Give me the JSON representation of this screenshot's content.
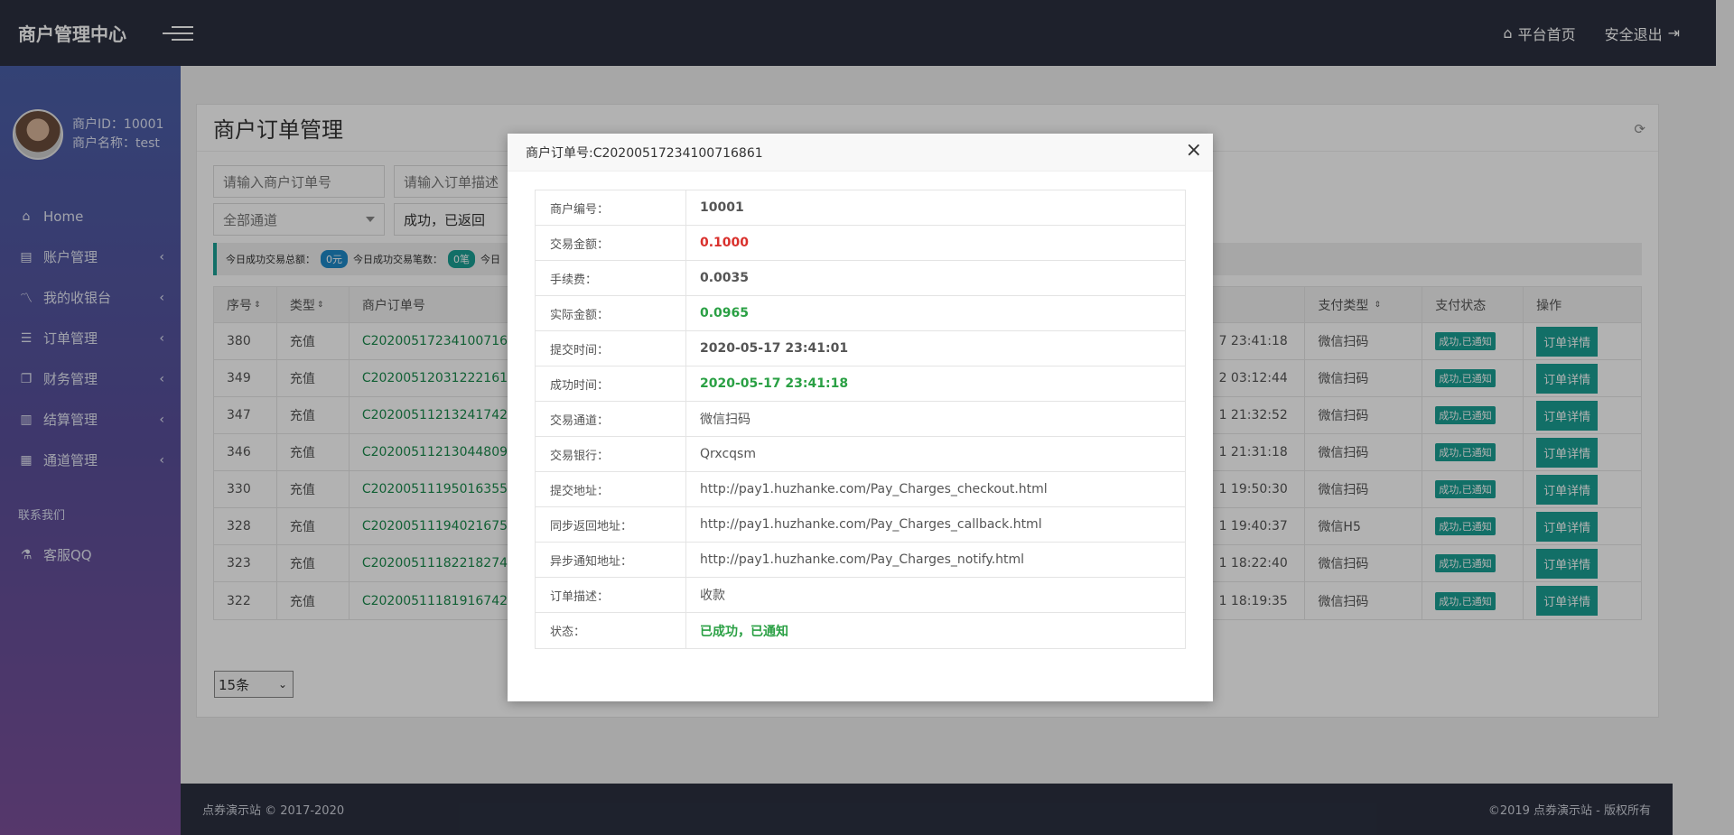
{
  "topbar": {
    "brand": "商户管理中心",
    "home_link": "平台首页",
    "logout_link": "安全退出"
  },
  "sidebar": {
    "merchant_id": "商户ID：10001",
    "merchant_name": "商户名称：test",
    "items": [
      {
        "label": "Home",
        "icon": "home-icon"
      },
      {
        "label": "账户管理",
        "icon": "clipboard-icon"
      },
      {
        "label": "我的收银台",
        "icon": "chart-line-icon"
      },
      {
        "label": "订单管理",
        "icon": "list-icon"
      },
      {
        "label": "财务管理",
        "icon": "copy-icon"
      },
      {
        "label": "结算管理",
        "icon": "bar-chart-icon"
      },
      {
        "label": "通道管理",
        "icon": "hdd-icon"
      }
    ],
    "section_label": "联系我们",
    "qq_item": "客服QQ"
  },
  "main": {
    "title": "商户订单管理",
    "filters": {
      "order_no_placeholder": "请输入商户订单号",
      "desc_placeholder": "请输入订单描述",
      "channel_selected": "全部通道",
      "status_selected": "成功，已返回"
    },
    "stats": {
      "total_label": "今日成功交易总额：",
      "total_value": "0元",
      "count_label": "今日成功交易笔数：",
      "count_value": "0笔",
      "more_label": "今日"
    },
    "table": {
      "headers": [
        "序号",
        "类型",
        "商户订单号",
        "",
        "支付类型",
        "支付状态",
        "操作"
      ],
      "rows": [
        {
          "id": "380",
          "type": "充值",
          "order": "C2020051723410071686",
          "time": "7 23:41:18",
          "pay": "微信扫码",
          "status": "成功,已通知",
          "action": "订单详情"
        },
        {
          "id": "349",
          "type": "充值",
          "order": "C2020051203122216173",
          "time": "2 03:12:44",
          "pay": "微信扫码",
          "status": "成功,已通知",
          "action": "订单详情"
        },
        {
          "id": "347",
          "type": "充值",
          "order": "C2020051121324174219",
          "time": "1 21:32:52",
          "pay": "微信扫码",
          "status": "成功,已通知",
          "action": "订单详情"
        },
        {
          "id": "346",
          "type": "充值",
          "order": "C2020051121304480972",
          "time": "1 21:31:18",
          "pay": "微信扫码",
          "status": "成功,已通知",
          "action": "订单详情"
        },
        {
          "id": "330",
          "type": "充值",
          "order": "C2020051119501635555",
          "time": "1 19:50:30",
          "pay": "微信扫码",
          "status": "成功,已通知",
          "action": "订单详情"
        },
        {
          "id": "328",
          "type": "充值",
          "order": "C2020051119402167599",
          "time": "1 19:40:37",
          "pay": "微信H5",
          "status": "成功,已通知",
          "action": "订单详情"
        },
        {
          "id": "323",
          "type": "充值",
          "order": "C2020051118221827465",
          "time": "1 18:22:40",
          "pay": "微信扫码",
          "status": "成功,已通知",
          "action": "订单详情"
        },
        {
          "id": "322",
          "type": "充值",
          "order": "C2020051118191674225",
          "time": "1 18:19:35",
          "pay": "微信扫码",
          "status": "成功,已通知",
          "action": "订单详情"
        }
      ]
    },
    "page_size": "15条"
  },
  "footer": {
    "left": "点券演示站 © 2017-2020",
    "right": "©2019 点券演示站 - 版权所有"
  },
  "modal": {
    "title": "商户订单号:C20200517234100716861",
    "rows": [
      {
        "label": "商户编号：",
        "value": "10001",
        "color": "#555555",
        "bold": true
      },
      {
        "label": "交易金额：",
        "value": "0.1000",
        "color": "#d9302c",
        "bold": true
      },
      {
        "label": "手续费：",
        "value": "0.0035",
        "color": "#555555",
        "bold": true
      },
      {
        "label": "实际金额：",
        "value": "0.0965",
        "color": "#2aa044",
        "bold": true
      },
      {
        "label": "提交时间：",
        "value": "2020-05-17 23:41:01",
        "color": "#555555",
        "bold": true
      },
      {
        "label": "成功时间：",
        "value": "2020-05-17 23:41:18",
        "color": "#2aa044",
        "bold": true
      },
      {
        "label": "交易通道：",
        "value": "微信扫码",
        "color": "#555555",
        "bold": false
      },
      {
        "label": "交易银行：",
        "value": "Qrxcqsm",
        "color": "#555555",
        "bold": false
      },
      {
        "label": "提交地址：",
        "value": "http://pay1.huzhanke.com/Pay_Charges_checkout.html",
        "color": "#555555",
        "bold": false
      },
      {
        "label": "同步返回地址：",
        "value": "http://pay1.huzhanke.com/Pay_Charges_callback.html",
        "color": "#555555",
        "bold": false
      },
      {
        "label": "异步通知地址：",
        "value": "http://pay1.huzhanke.com/Pay_Charges_notify.html",
        "color": "#555555",
        "bold": false
      },
      {
        "label": "订单描述：",
        "value": "收款",
        "color": "#555555",
        "bold": false
      },
      {
        "label": "状态：",
        "value": "已成功，已通知",
        "color": "#2aa044",
        "bold": true
      }
    ]
  }
}
